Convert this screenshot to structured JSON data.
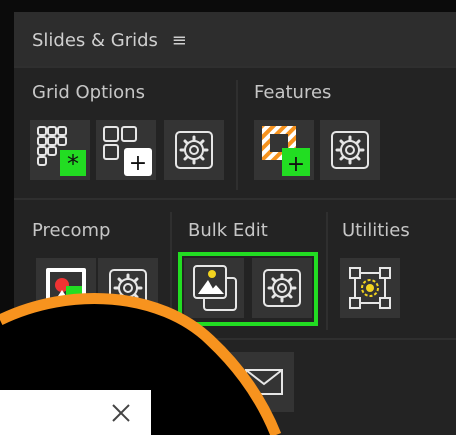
{
  "panel": {
    "title": "Slides & Grids",
    "menu_icon": "hamburger-menu-icon"
  },
  "sections": {
    "grid_options": "Grid Options",
    "features": "Features",
    "precomp": "Precomp",
    "bulk_edit": "Bulk Edit",
    "utilities": "Utilities"
  },
  "colors": {
    "accent_green": "#22dd22",
    "orange_curve": "#f7931e",
    "icon_stroke": "#e6e6e6",
    "button_bg": "#343434",
    "panel_bg": "#232323"
  },
  "icons": {
    "grid_new": "grid-new-icon",
    "grid_add": "grid-add-icon",
    "settings": "gear-icon",
    "feature_add": "feature-add-icon",
    "precomp": "precomp-icon",
    "bulk_image": "bulk-image-icon",
    "utilities": "utilities-select-icon",
    "info": "info-icon",
    "mail": "mail-icon",
    "close": "close-icon"
  }
}
